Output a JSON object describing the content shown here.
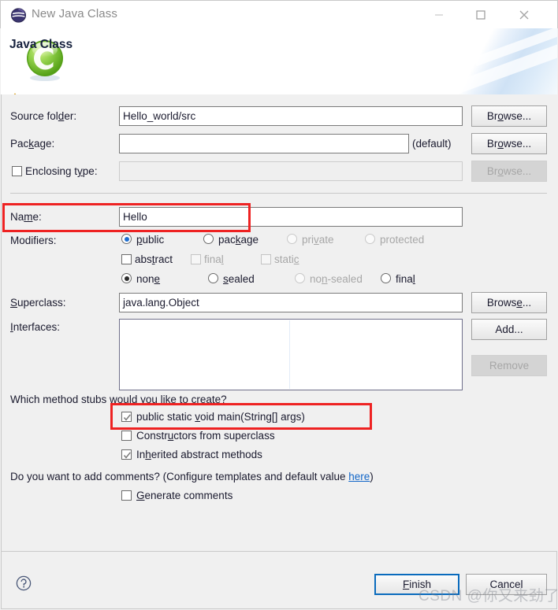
{
  "window": {
    "title": "New Java Class",
    "icon": "eclipse-icon",
    "controls": {
      "minimize": "minimize-icon",
      "maximize": "maximize-icon",
      "close": "close-icon"
    }
  },
  "header": {
    "title": "Java Class",
    "message": "The use of the default package is discouraged.",
    "message_icon": "warning-icon",
    "banner_icon": "java-class-c-icon"
  },
  "form": {
    "source_folder": {
      "label": "Source folder:",
      "value": "Hello_world/src",
      "browse": "Browse..."
    },
    "package": {
      "label": "Package:",
      "value": "",
      "hint": "(default)",
      "browse": "Browse..."
    },
    "enclosing_type": {
      "label": "Enclosing type:",
      "checked": false,
      "value": "",
      "browse": "Browse..."
    },
    "name": {
      "label": "Name:",
      "value": "Hello"
    },
    "modifiers": {
      "label": "Modifiers:",
      "access": [
        {
          "label": "public",
          "selected": true,
          "enabled": true
        },
        {
          "label": "package",
          "selected": false,
          "enabled": true
        },
        {
          "label": "private",
          "selected": false,
          "enabled": false
        },
        {
          "label": "protected",
          "selected": false,
          "enabled": false
        }
      ],
      "flags": [
        {
          "label": "abstract",
          "checked": false,
          "enabled": true
        },
        {
          "label": "final",
          "checked": false,
          "enabled": false
        },
        {
          "label": "static",
          "checked": false,
          "enabled": false
        }
      ],
      "sealed": [
        {
          "label": "none",
          "selected": true,
          "enabled": true
        },
        {
          "label": "sealed",
          "selected": false,
          "enabled": true
        },
        {
          "label": "non-sealed",
          "selected": false,
          "enabled": false
        },
        {
          "label": "final",
          "selected": false,
          "enabled": true
        }
      ]
    },
    "superclass": {
      "label": "Superclass:",
      "value": "java.lang.Object",
      "browse": "Browse..."
    },
    "interfaces": {
      "label": "Interfaces:",
      "items": [],
      "add": "Add...",
      "remove": "Remove"
    }
  },
  "stubs": {
    "question": "Which method stubs would you like to create?",
    "options": [
      {
        "label": "public static void main(String[] args)",
        "checked": true
      },
      {
        "label": "Constructors from superclass",
        "checked": false
      },
      {
        "label": "Inherited abstract methods",
        "checked": true
      }
    ]
  },
  "comments": {
    "question_prefix": "Do you want to add comments? (Configure templates and default value ",
    "link": "here",
    "question_suffix": ")",
    "generate": {
      "label": "Generate comments",
      "checked": false
    }
  },
  "footer": {
    "help_icon": "help-icon",
    "finish": "Finish",
    "cancel": "Cancel"
  },
  "watermark": "CSDN @你又来劲了",
  "colors": {
    "accent": "#0a6bbd",
    "annotation": "#ee2222",
    "link": "#1266c8",
    "radio_selected": "#1f6fd0",
    "dialog_bg": "#f0f0f0"
  }
}
